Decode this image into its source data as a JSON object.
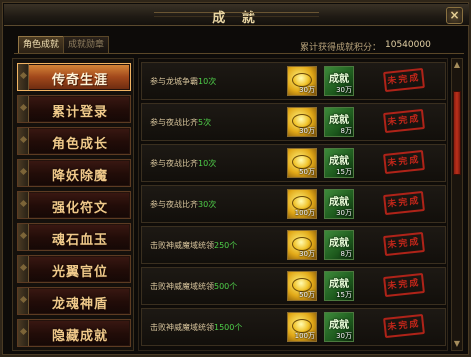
{
  "window": {
    "title": "成 就",
    "close_label": "×"
  },
  "tabs": [
    {
      "label": "角色成就",
      "active": true
    },
    {
      "label": "成就勋章",
      "active": false
    }
  ],
  "score": {
    "label": "累计获得成就积分：",
    "value": "10540000"
  },
  "sidebar": {
    "items": [
      {
        "label": "传奇生涯",
        "active": true
      },
      {
        "label": "累计登录",
        "active": false
      },
      {
        "label": "角色成长",
        "active": false
      },
      {
        "label": "降妖除魔",
        "active": false
      },
      {
        "label": "强化符文",
        "active": false
      },
      {
        "label": "魂石血玉",
        "active": false
      },
      {
        "label": "光翼官位",
        "active": false
      },
      {
        "label": "龙魂神盾",
        "active": false
      },
      {
        "label": "隐藏成就",
        "active": false
      }
    ]
  },
  "achievements": [
    {
      "prefix": "参与龙城争霸",
      "count": "10",
      "suffix": "次",
      "gold_qty": "30万",
      "points_label": "成就",
      "points_qty": "30万",
      "status": "未完成"
    },
    {
      "prefix": "参与夜战比齐",
      "count": "5",
      "suffix": "次",
      "gold_qty": "30万",
      "points_label": "成就",
      "points_qty": "8万",
      "status": "未完成"
    },
    {
      "prefix": "参与夜战比齐",
      "count": "10",
      "suffix": "次",
      "gold_qty": "50万",
      "points_label": "成就",
      "points_qty": "15万",
      "status": "未完成"
    },
    {
      "prefix": "参与夜战比齐",
      "count": "30",
      "suffix": "次",
      "gold_qty": "100万",
      "points_label": "成就",
      "points_qty": "30万",
      "status": "未完成"
    },
    {
      "prefix": "击败神威魔域统领",
      "count": "250",
      "suffix": "个",
      "gold_qty": "30万",
      "points_label": "成就",
      "points_qty": "8万",
      "status": "未完成"
    },
    {
      "prefix": "击败神威魔域统领",
      "count": "500",
      "suffix": "个",
      "gold_qty": "50万",
      "points_label": "成就",
      "points_qty": "15万",
      "status": "未完成"
    },
    {
      "prefix": "击败神威魔域统领",
      "count": "1500",
      "suffix": "个",
      "gold_qty": "100万",
      "points_label": "成就",
      "points_qty": "30万",
      "status": "未完成"
    }
  ],
  "colors": {
    "accent": "#d98a3a",
    "count_green": "#4fd04a",
    "stamp_red": "#c0251a"
  }
}
